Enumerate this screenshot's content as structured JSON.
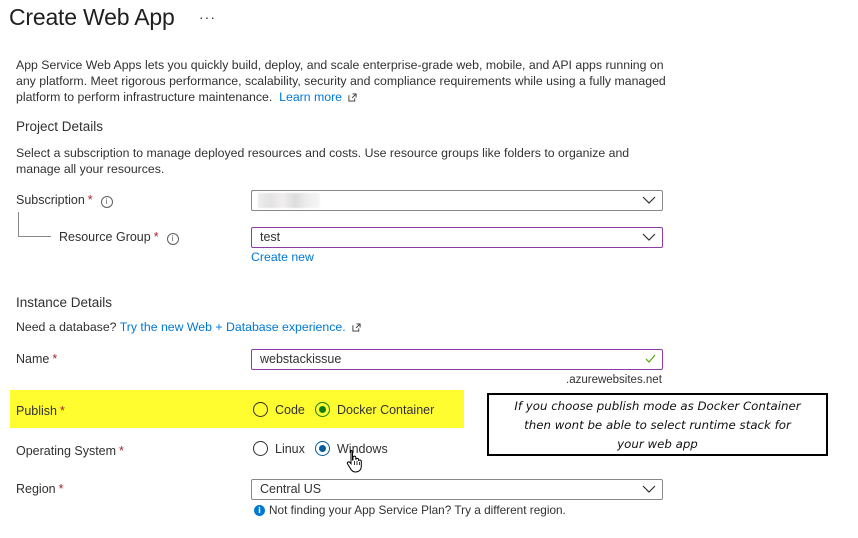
{
  "page": {
    "title": "Create Web App",
    "more_actions": "···"
  },
  "intro": {
    "text": "App Service Web Apps lets you quickly build, deploy, and scale enterprise-grade web, mobile, and API apps running on any platform. Meet rigorous performance, scalability, security and compliance requirements while using a fully managed platform to perform infrastructure maintenance.",
    "learn_more": "Learn more"
  },
  "project_details": {
    "heading": "Project Details",
    "description": "Select a subscription to manage deployed resources and costs. Use resource groups like folders to organize and manage all your resources.",
    "subscription": {
      "label": "Subscription",
      "required": "*",
      "value": ""
    },
    "resource_group": {
      "label": "Resource Group",
      "required": "*",
      "value": "test",
      "create_new": "Create new"
    }
  },
  "instance_details": {
    "heading": "Instance Details",
    "db_prompt": "Need a database?",
    "db_link": "Try the new Web + Database experience.",
    "name": {
      "label": "Name",
      "required": "*",
      "value": "webstackissue",
      "suffix": ".azurewebsites.net",
      "valid": true
    },
    "publish": {
      "label": "Publish",
      "required": "*",
      "options": [
        "Code",
        "Docker Container"
      ],
      "selected": "Docker Container"
    },
    "operating_system": {
      "label": "Operating System",
      "required": "*",
      "options": [
        "Linux",
        "Windows"
      ],
      "selected": "Windows"
    },
    "region": {
      "label": "Region",
      "required": "*",
      "value": "Central US",
      "hint": "Not finding your App Service Plan? Try a different region."
    }
  },
  "annotation": {
    "text_line1": "If you choose publish mode as Docker Container",
    "text_line2": "then wont be able to select runtime stack for",
    "text_line3": "your web app"
  },
  "colors": {
    "link": "#0078d4",
    "required": "#a4262c",
    "focus_border": "#8a3da9",
    "highlight": "#fffc30",
    "radio_selected_publish": "#107c10",
    "radio_selected_os": "#005a9e",
    "valid_check": "#57a300"
  }
}
